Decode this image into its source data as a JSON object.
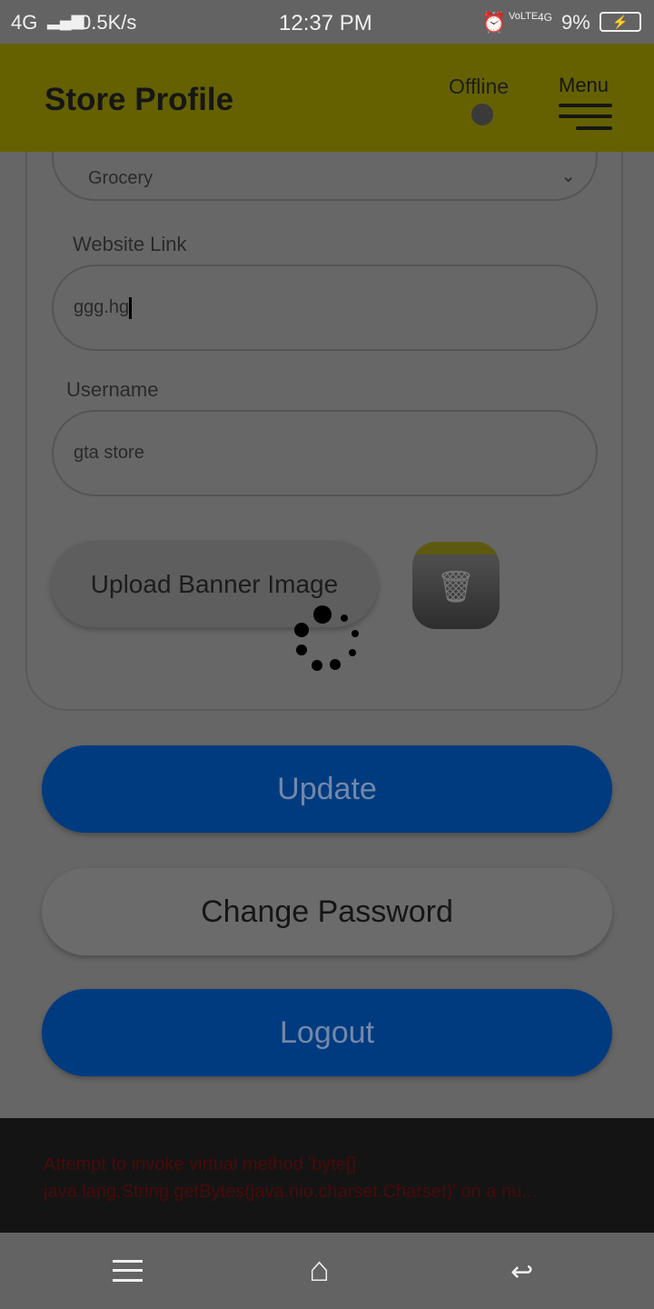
{
  "status_bar": {
    "network": "4G",
    "speed": "0.5K/s",
    "time": "12:37 PM",
    "lte": "VoLTE",
    "data": "4G",
    "battery": "9%"
  },
  "header": {
    "title": "Store Profile",
    "status": "Offline",
    "menu_label": "Menu"
  },
  "form": {
    "category_value": "Grocery",
    "website_label": "Website Link",
    "website_value": "ggg.hg",
    "username_label": "Username",
    "username_value": "gta store",
    "upload_label": "Upload Banner Image"
  },
  "buttons": {
    "update": "Update",
    "change_password": "Change Password",
    "logout": "Logout"
  },
  "toast": {
    "message": "Attempt to invoke virtual method 'byte[] java.lang.String.getBytes(java.nio.charset.Charset)' on a nu..."
  },
  "colors": {
    "header": "#c8c200",
    "primary": "#0066d6",
    "error": "#8b0000"
  }
}
